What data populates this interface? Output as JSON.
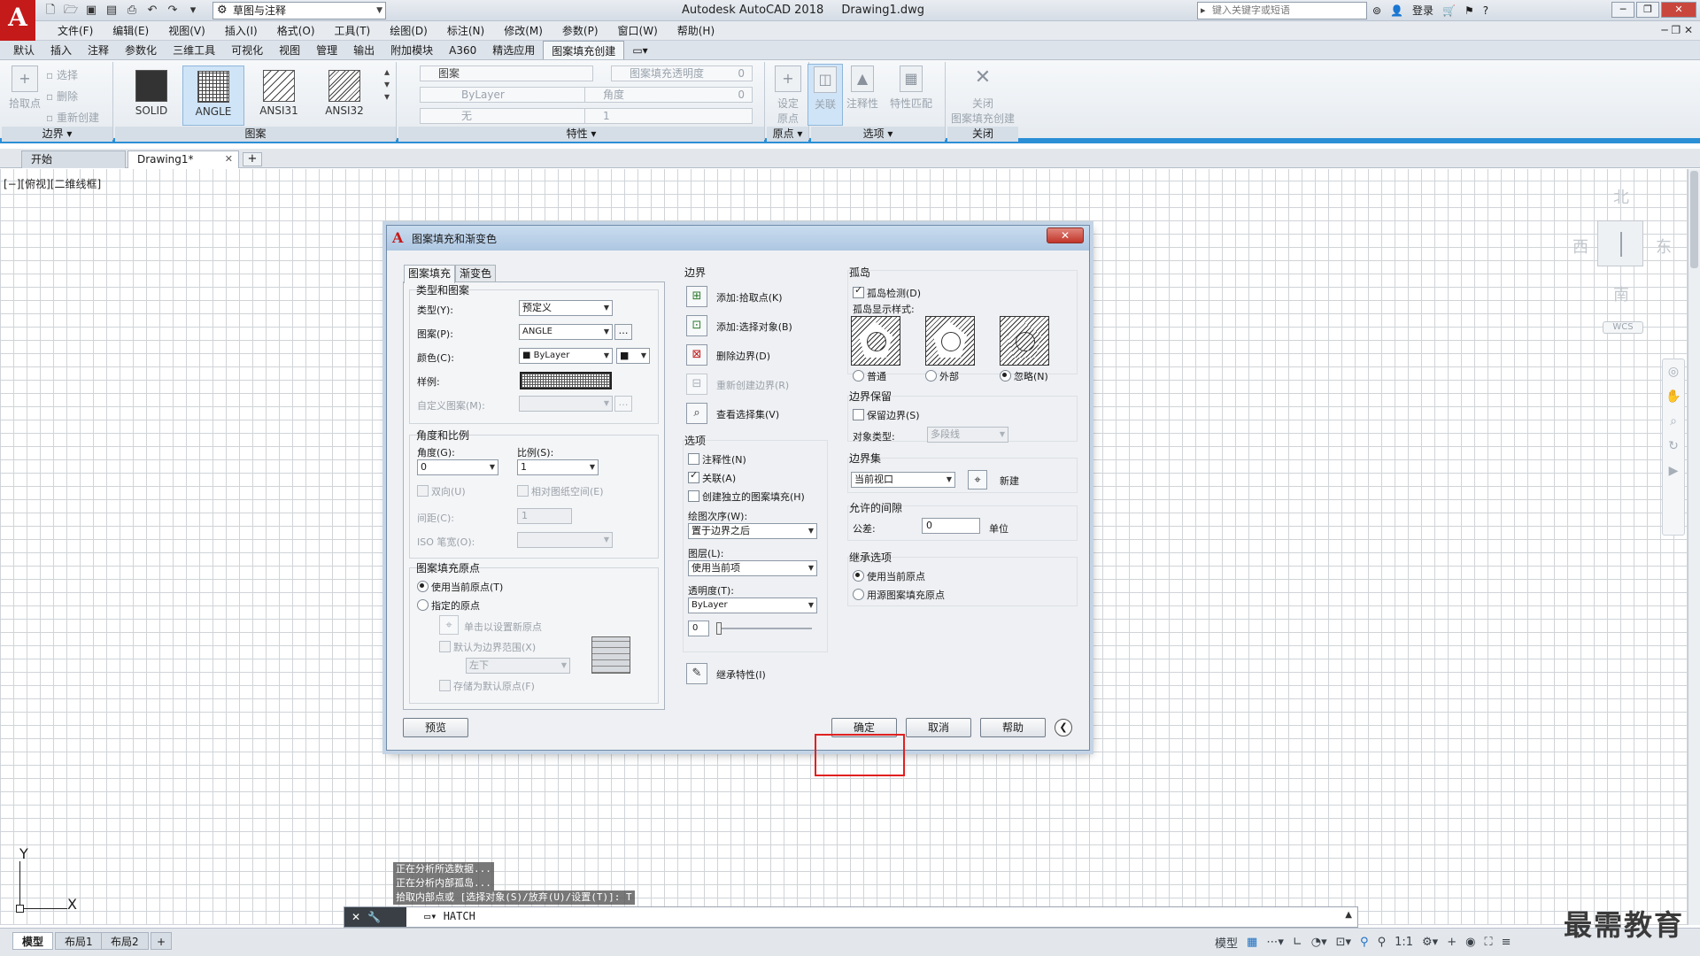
{
  "app": {
    "logo_letter": "A",
    "workspace": "草图与注释",
    "title_app": "Autodesk AutoCAD 2018",
    "title_doc": "Drawing1.dwg",
    "search_placeholder": "键入关键字或短语",
    "signin": "登录"
  },
  "menu": [
    "文件(F)",
    "编辑(E)",
    "视图(V)",
    "插入(I)",
    "格式(O)",
    "工具(T)",
    "绘图(D)",
    "标注(N)",
    "修改(M)",
    "参数(P)",
    "窗口(W)",
    "帮助(H)"
  ],
  "ribbon_tabs": [
    "默认",
    "插入",
    "注释",
    "参数化",
    "三维工具",
    "可视化",
    "视图",
    "管理",
    "输出",
    "附加模块",
    "A360",
    "精选应用",
    "图案填充创建"
  ],
  "ribbon": {
    "boundary": {
      "pick_point": "拾取点",
      "select": "选择",
      "remove": "删除",
      "recreate": "重新创建",
      "title": "边界"
    },
    "pattern": {
      "items": [
        "SOLID",
        "ANGLE",
        "ANSI31",
        "ANSI32"
      ],
      "selected": "ANGLE",
      "title": "图案"
    },
    "properties": {
      "type": "图案",
      "transparency": "图案填充透明度",
      "transparency_value": "0",
      "color": "ByLayer",
      "angle": "角度",
      "angle_value": "0",
      "background": "无",
      "scale": "1",
      "title": "特性"
    },
    "origin": {
      "set": "设定",
      "origin_label": "原点",
      "title": "原点"
    },
    "options": {
      "associative": "关联",
      "annotative": "注释性",
      "match": "特性匹配",
      "title": "选项"
    },
    "close": {
      "label1": "关闭",
      "label2": "图案填充创建",
      "title": "关闭"
    }
  },
  "doc_tabs": {
    "start": "开始",
    "drawing": "Drawing1*"
  },
  "viewport_label": "[−][俯视][二维线框]",
  "viewcube": {
    "north": "北",
    "south": "南",
    "east": "东",
    "west": "西",
    "wcs": "WCS"
  },
  "ucs": {
    "x": "X",
    "y": "Y"
  },
  "command": {
    "history": [
      "正在分析所选数据...",
      "正在分析内部孤岛...",
      "拾取内部点或 [选择对象(S)/放弃(U)/设置(T)]: T"
    ],
    "current": "HATCH"
  },
  "status": {
    "layouts": [
      "模型",
      "布局1",
      "布局2"
    ],
    "model": "模型",
    "scale": "1:1"
  },
  "watermark": "最需教育",
  "dialog": {
    "title": "图案填充和渐变色",
    "close_label": "✕",
    "tabs": [
      "图案填充",
      "渐变色"
    ],
    "type_pattern": {
      "title": "类型和图案",
      "type_label": "类型(Y):",
      "type_value": "预定义",
      "pattern_label": "图案(P):",
      "pattern_value": "ANGLE",
      "color_label": "颜色(C):",
      "color_value": "ByLayer",
      "sample_label": "样例:",
      "custom_label": "自定义图案(M):"
    },
    "angle_scale": {
      "title": "角度和比例",
      "angle_label": "角度(G):",
      "angle_value": "0",
      "scale_label": "比例(S):",
      "scale_value": "1",
      "double": "双向(U)",
      "relative": "相对图纸空间(E)",
      "spacing_label": "间距(C):",
      "spacing_value": "1",
      "iso_label": "ISO 笔宽(O):"
    },
    "hatch_origin": {
      "title": "图案填充原点",
      "use_current": "使用当前原点(T)",
      "specified": "指定的原点",
      "click_set": "单击以设置新原点",
      "default_extents": "默认为边界范围(X)",
      "position": "左下",
      "store_default": "存储为默认原点(F)"
    },
    "boundaries": {
      "title": "边界",
      "add_pick": "添加:拾取点(K)",
      "add_select": "添加:选择对象(B)",
      "remove": "删除边界(D)",
      "recreate": "重新创建边界(R)",
      "view_selections": "查看选择集(V)"
    },
    "options": {
      "title": "选项",
      "annotative": "注释性(N)",
      "associative": "关联(A)",
      "separate": "创建独立的图案填充(H)",
      "draw_order_label": "绘图次序(W):",
      "draw_order_value": "置于边界之后",
      "layer_label": "图层(L):",
      "layer_value": "使用当前项",
      "transparency_label": "透明度(T):",
      "transparency_value": "ByLayer",
      "transparency_amount": "0",
      "transparency_fraction": 0.0
    },
    "inherit": "继承特性(I)",
    "islands": {
      "title": "孤岛",
      "detection": "孤岛检测(D)",
      "display_style": "孤岛显示样式:",
      "normal": "普通",
      "outer": "外部",
      "ignore": "忽略(N)"
    },
    "boundary_retention": {
      "title": "边界保留",
      "retain": "保留边界(S)",
      "object_type_label": "对象类型:",
      "object_type_value": "多段线"
    },
    "boundary_set": {
      "title": "边界集",
      "value": "当前视口",
      "new": "新建"
    },
    "gap": {
      "title": "允许的间隙",
      "tolerance_label": "公差:",
      "tolerance_value": "0",
      "unit": "单位"
    },
    "inherit_options": {
      "title": "继承选项",
      "use_current": "使用当前原点",
      "use_source": "用源图案填充原点"
    },
    "buttons": {
      "preview": "预览",
      "ok": "确定",
      "cancel": "取消",
      "help": "帮助"
    }
  }
}
